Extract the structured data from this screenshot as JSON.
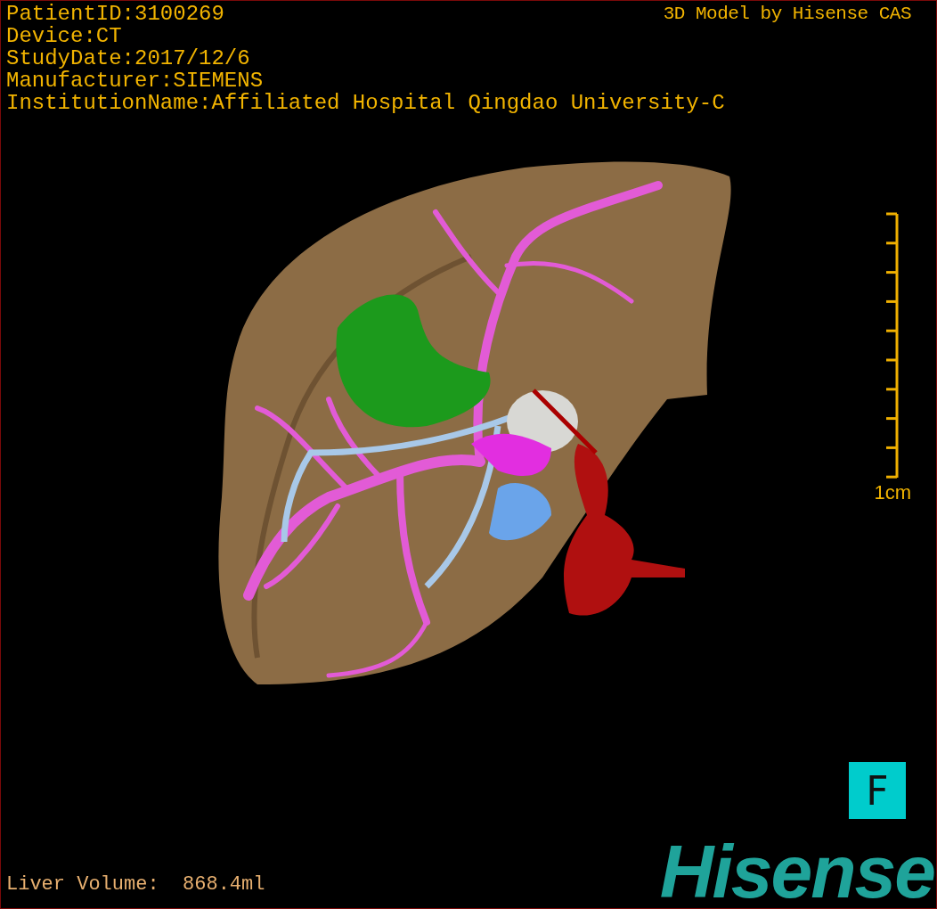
{
  "overlay": {
    "info_lines": [
      "PatientID:3100269",
      "Device:CT",
      "StudyDate:2017/12/6",
      "Manufacturer:SIEMENS",
      "InstitutionName:Affiliated Hospital Qingdao University-C"
    ],
    "title": "3D Model by Hisense CAS"
  },
  "scale_bar": {
    "label": "1cm"
  },
  "orientation_marker": "F",
  "liver_volume": "Liver Volume:  868.4ml",
  "logo": "Hisense"
}
